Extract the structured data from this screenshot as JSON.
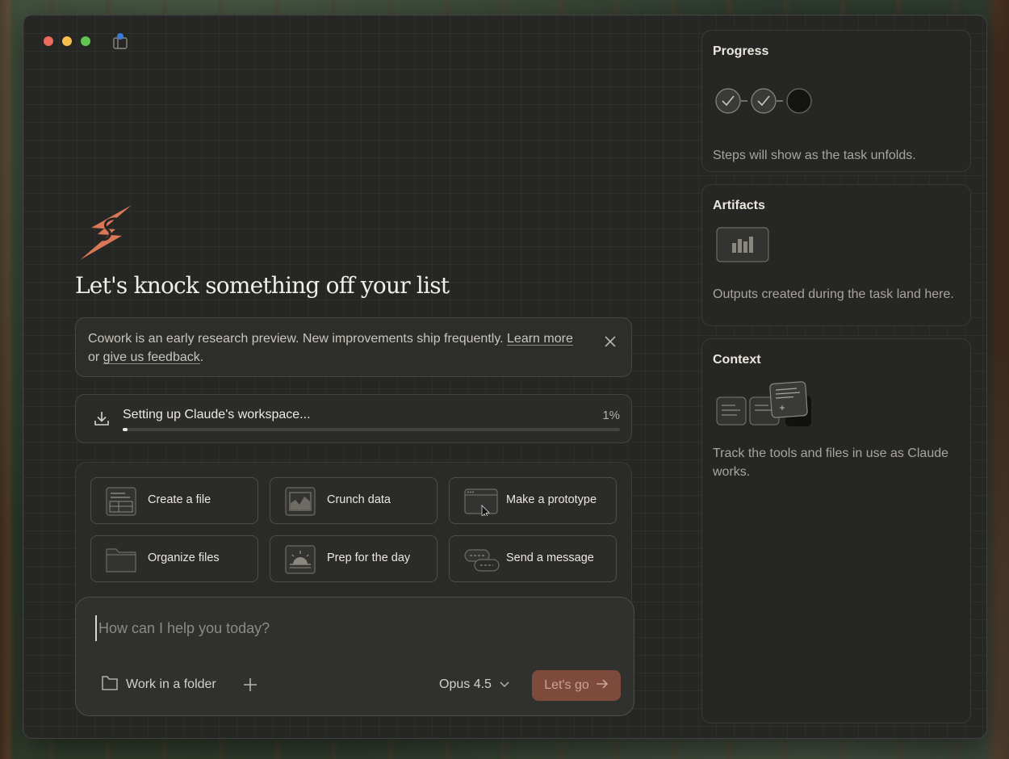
{
  "headline": "Let's knock something off your list",
  "notice": {
    "text_before": "Cowork is an early research preview. New improvements ship frequently. ",
    "learn_more": "Learn more",
    "or": " or ",
    "feedback": "give us feedback",
    "period": "."
  },
  "setup": {
    "label": "Setting up Claude's workspace...",
    "percent_text": "1%",
    "progress": 0.01
  },
  "actions": [
    {
      "label": "Create a file",
      "icon": "file-document-icon"
    },
    {
      "label": "Crunch data",
      "icon": "chart-area-icon"
    },
    {
      "label": "Make a prototype",
      "icon": "browser-window-icon"
    },
    {
      "label": "Organize files",
      "icon": "folder-icon"
    },
    {
      "label": "Prep for the day",
      "icon": "sunrise-icon"
    },
    {
      "label": "Send a message",
      "icon": "chat-bubbles-icon"
    }
  ],
  "composer": {
    "placeholder": "How can I help you today?",
    "folder_label": "Work in a folder",
    "model": "Opus 4.5",
    "submit_label": "Let's go"
  },
  "sidebar": {
    "progress": {
      "title": "Progress",
      "description": "Steps will show as the task unfolds."
    },
    "artifacts": {
      "title": "Artifacts",
      "description": "Outputs created during the task land here."
    },
    "context": {
      "title": "Context",
      "description": "Track the tools and files in use as Claude works."
    }
  },
  "colors": {
    "accent": "#d97757",
    "button": "#7d4a3c"
  }
}
